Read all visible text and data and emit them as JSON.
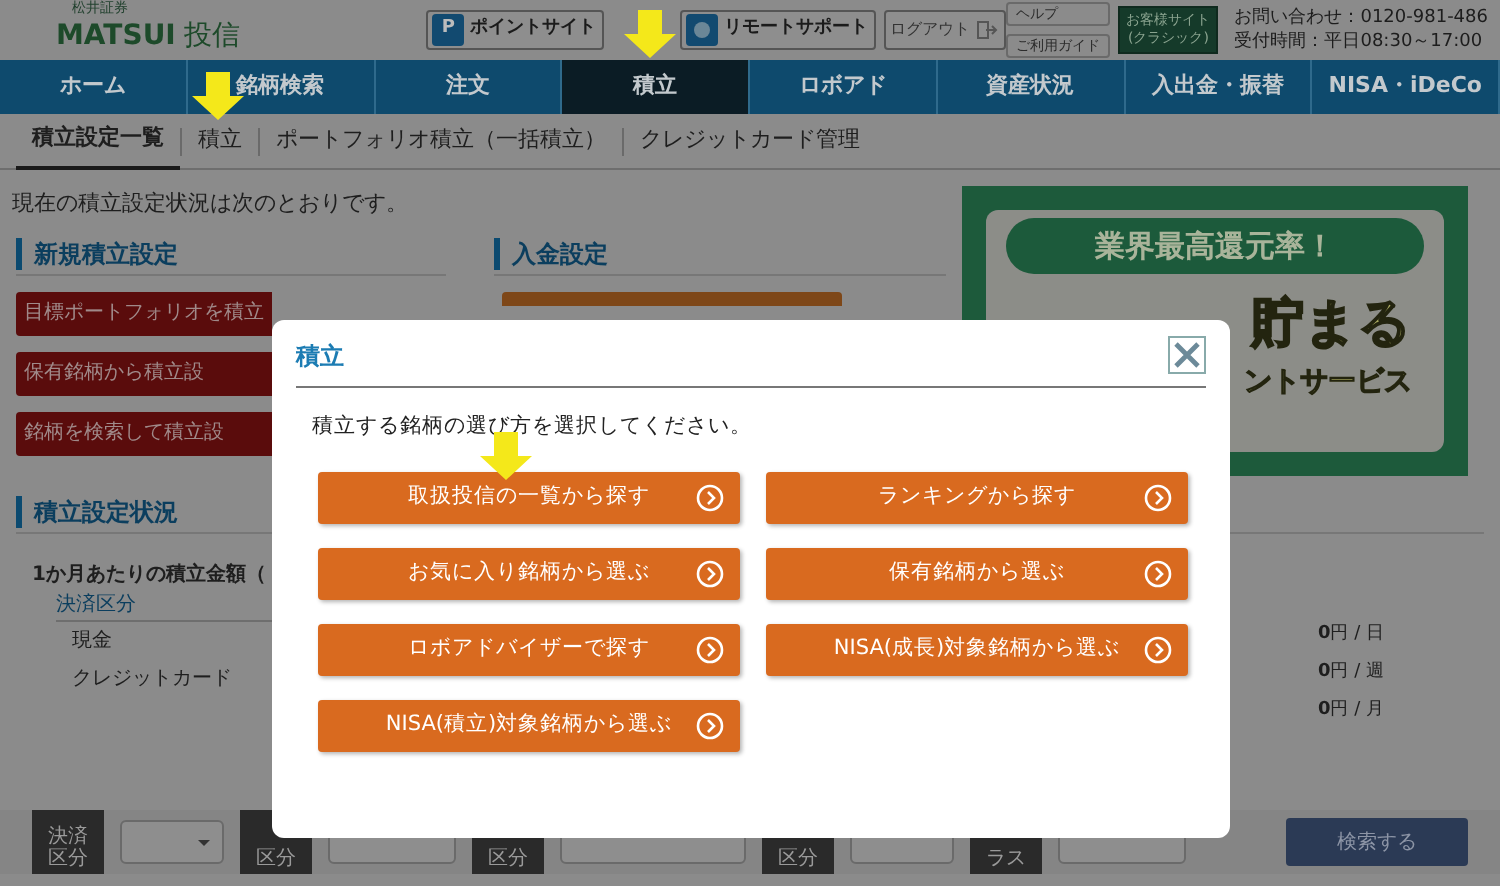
{
  "header": {
    "logo_caption": "松井証券",
    "logo_brand": "MATSUI",
    "logo_suffix": "投信",
    "buttons": [
      {
        "kind": "point",
        "icon": "P",
        "label": "ポイントサイト"
      },
      {
        "kind": "remote",
        "label": "リモートサポート"
      },
      {
        "kind": "logout",
        "label": "ログアウト"
      }
    ],
    "help_links": [
      "ヘルプ",
      "ご利用ガイド"
    ],
    "classic_site": [
      "お客様サイト",
      "(クラシック)"
    ],
    "contact_label": "お問い合わせ：",
    "phone": "0120-981-486",
    "hours": "受付時間：平日08:30～17:00"
  },
  "nav": [
    {
      "label": "ホーム",
      "selected": false,
      "arrow": false
    },
    {
      "label": "銘柄検索",
      "selected": false,
      "arrow": false
    },
    {
      "label": "注文",
      "selected": false,
      "arrow": false
    },
    {
      "label": "積立",
      "selected": true,
      "arrow": true
    },
    {
      "label": "ロボアド",
      "selected": false,
      "arrow": false
    },
    {
      "label": "資産状況",
      "selected": false,
      "arrow": false
    },
    {
      "label": "入出金・振替",
      "selected": false,
      "arrow": false
    },
    {
      "label": "NISA・iDeCo",
      "selected": false,
      "arrow": false
    }
  ],
  "subnav": [
    {
      "label": "積立設定一覧",
      "selected": true,
      "arrow": false
    },
    {
      "label": "積立",
      "selected": false,
      "arrow": true
    },
    {
      "label": "ポートフォリオ積立（一括積立）",
      "selected": false,
      "arrow": false
    },
    {
      "label": "クレジットカード管理",
      "selected": false,
      "arrow": false
    }
  ],
  "intro": "現在の積立設定状況は次のとおりです。",
  "new_setting": {
    "title": "新規積立設定",
    "buttons": [
      "目標ポートフォリオを積立",
      "保有銘柄から積立設",
      "銘柄を検索して積立設"
    ]
  },
  "deposit_setting": {
    "title": "入金設定"
  },
  "banner": {
    "tagline": "業界最高還元率！",
    "headline": "貯まる",
    "subline": "ントサービス"
  },
  "status": {
    "title": "積立設定状況",
    "monthly": "1か月あたりの積立金額（",
    "column": "決済区分",
    "rows": [
      "現金",
      "クレジットカード"
    ],
    "amounts": [
      {
        "value": "0",
        "unit": "円 / 日"
      },
      {
        "value": "0",
        "unit": "円 / 週"
      },
      {
        "value": "0",
        "unit": "円 / 月"
      }
    ]
  },
  "filter": {
    "labels": [
      [
        "決済",
        "区分"
      ],
      [
        "区分"
      ],
      [
        "区分"
      ],
      [
        "区分"
      ],
      [
        "ラス"
      ]
    ],
    "search_button": "検索する"
  },
  "modal": {
    "title": "積立",
    "message": "積立する銘柄の選び方を選択してください。",
    "options": [
      {
        "label": "取扱投信の一覧から探す",
        "arrow": true
      },
      {
        "label": "ランキングから探す",
        "arrow": false
      },
      {
        "label": "お気に入り銘柄から選ぶ",
        "arrow": false
      },
      {
        "label": "保有銘柄から選ぶ",
        "arrow": false
      },
      {
        "label": "ロボアドバイザーで探す",
        "arrow": false
      },
      {
        "label": "NISA(成長)対象銘柄から選ぶ",
        "arrow": false
      },
      {
        "label": "NISA(積立)対象銘柄から選ぶ",
        "arrow": false
      }
    ]
  }
}
